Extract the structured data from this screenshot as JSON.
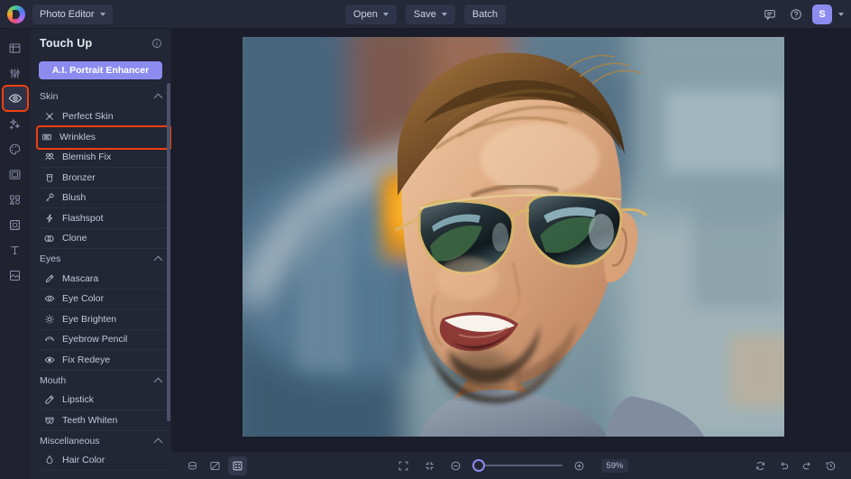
{
  "topbar": {
    "logo_icon": "bee-logo-icon",
    "app_switcher": {
      "label": "Photo Editor",
      "icon": "chevron-down-icon"
    },
    "center_buttons": [
      {
        "name": "open",
        "label": "Open",
        "has_caret": true
      },
      {
        "name": "save",
        "label": "Save",
        "has_caret": true
      },
      {
        "name": "batch",
        "label": "Batch",
        "has_caret": false
      }
    ],
    "right_icons": [
      {
        "name": "feedback-icon",
        "title": "Feedback"
      },
      {
        "name": "help-icon",
        "title": "Help"
      }
    ],
    "avatar": {
      "initial": "S",
      "color": "#8c8cf0"
    },
    "avatar_caret_icon": "chevron-down-icon"
  },
  "rail": {
    "items": [
      {
        "name": "crop-icon",
        "label": "Crop",
        "active": false
      },
      {
        "name": "adjust-sliders-icon",
        "label": "Adjust",
        "active": false
      },
      {
        "name": "eye-retouch-icon",
        "label": "Touch Up",
        "active": true
      },
      {
        "name": "effects-sparkle-icon",
        "label": "Effects",
        "active": false
      },
      {
        "name": "color-palette-icon",
        "label": "Color",
        "active": false
      },
      {
        "name": "frames-icon",
        "label": "Frames",
        "active": false
      },
      {
        "name": "graphics-icon",
        "label": "Graphics",
        "active": false
      },
      {
        "name": "overlays-icon",
        "label": "Overlays",
        "active": false
      },
      {
        "name": "text-icon",
        "label": "Text",
        "active": false
      },
      {
        "name": "layers-icon",
        "label": "Layers",
        "active": false
      }
    ],
    "active_outline_color": "#f2400f"
  },
  "panel": {
    "title": "Touch Up",
    "info_icon": "info-icon",
    "ai_button": {
      "label": "A.I. Portrait Enhancer",
      "color": "#8c8cf0"
    },
    "highlight_color": "#f2400f",
    "groups": [
      {
        "name": "skin",
        "label": "Skin",
        "expanded": true,
        "items": [
          {
            "label": "Perfect Skin",
            "icon": "perfect-skin-icon",
            "highlighted": false
          },
          {
            "label": "Wrinkles",
            "icon": "wrinkles-icon",
            "highlighted": true
          },
          {
            "label": "Blemish Fix",
            "icon": "blemish-fix-icon",
            "highlighted": false
          },
          {
            "label": "Bronzer",
            "icon": "bronzer-icon",
            "highlighted": false
          },
          {
            "label": "Blush",
            "icon": "blush-icon",
            "highlighted": false
          },
          {
            "label": "Flashspot",
            "icon": "flashspot-icon",
            "highlighted": false
          },
          {
            "label": "Clone",
            "icon": "clone-icon",
            "highlighted": false
          }
        ]
      },
      {
        "name": "eyes",
        "label": "Eyes",
        "expanded": true,
        "items": [
          {
            "label": "Mascara",
            "icon": "mascara-icon",
            "highlighted": false
          },
          {
            "label": "Eye Color",
            "icon": "eye-color-icon",
            "highlighted": false
          },
          {
            "label": "Eye Brighten",
            "icon": "eye-brighten-icon",
            "highlighted": false
          },
          {
            "label": "Eyebrow Pencil",
            "icon": "eyebrow-pencil-icon",
            "highlighted": false
          },
          {
            "label": "Fix Redeye",
            "icon": "fix-redeye-icon",
            "highlighted": false
          }
        ]
      },
      {
        "name": "mouth",
        "label": "Mouth",
        "expanded": true,
        "items": [
          {
            "label": "Lipstick",
            "icon": "lipstick-icon",
            "highlighted": false
          },
          {
            "label": "Teeth Whiten",
            "icon": "teeth-whiten-icon",
            "highlighted": false
          }
        ]
      },
      {
        "name": "miscellaneous",
        "label": "Miscellaneous",
        "expanded": true,
        "items": [
          {
            "label": "Hair Color",
            "icon": "hair-color-icon",
            "highlighted": false
          }
        ]
      }
    ]
  },
  "canvas": {
    "image_description": "Smiling man wearing aviator sunglasses, blurred city street background with orange traffic light"
  },
  "bottombar": {
    "left_icons": [
      {
        "name": "layers-stack-icon",
        "selected": false
      },
      {
        "name": "compare-icon",
        "selected": false
      },
      {
        "name": "grid-view-icon",
        "selected": true
      }
    ],
    "fit_icons": [
      {
        "name": "fit-to-screen-icon"
      },
      {
        "name": "actual-size-icon"
      }
    ],
    "zoom": {
      "out_icon": "zoom-out-icon",
      "in_icon": "zoom-in-icon",
      "value": "59%",
      "percent": 59
    },
    "right_icons": [
      {
        "name": "reset-icon"
      },
      {
        "name": "undo-icon"
      },
      {
        "name": "redo-icon"
      },
      {
        "name": "history-icon"
      }
    ]
  }
}
